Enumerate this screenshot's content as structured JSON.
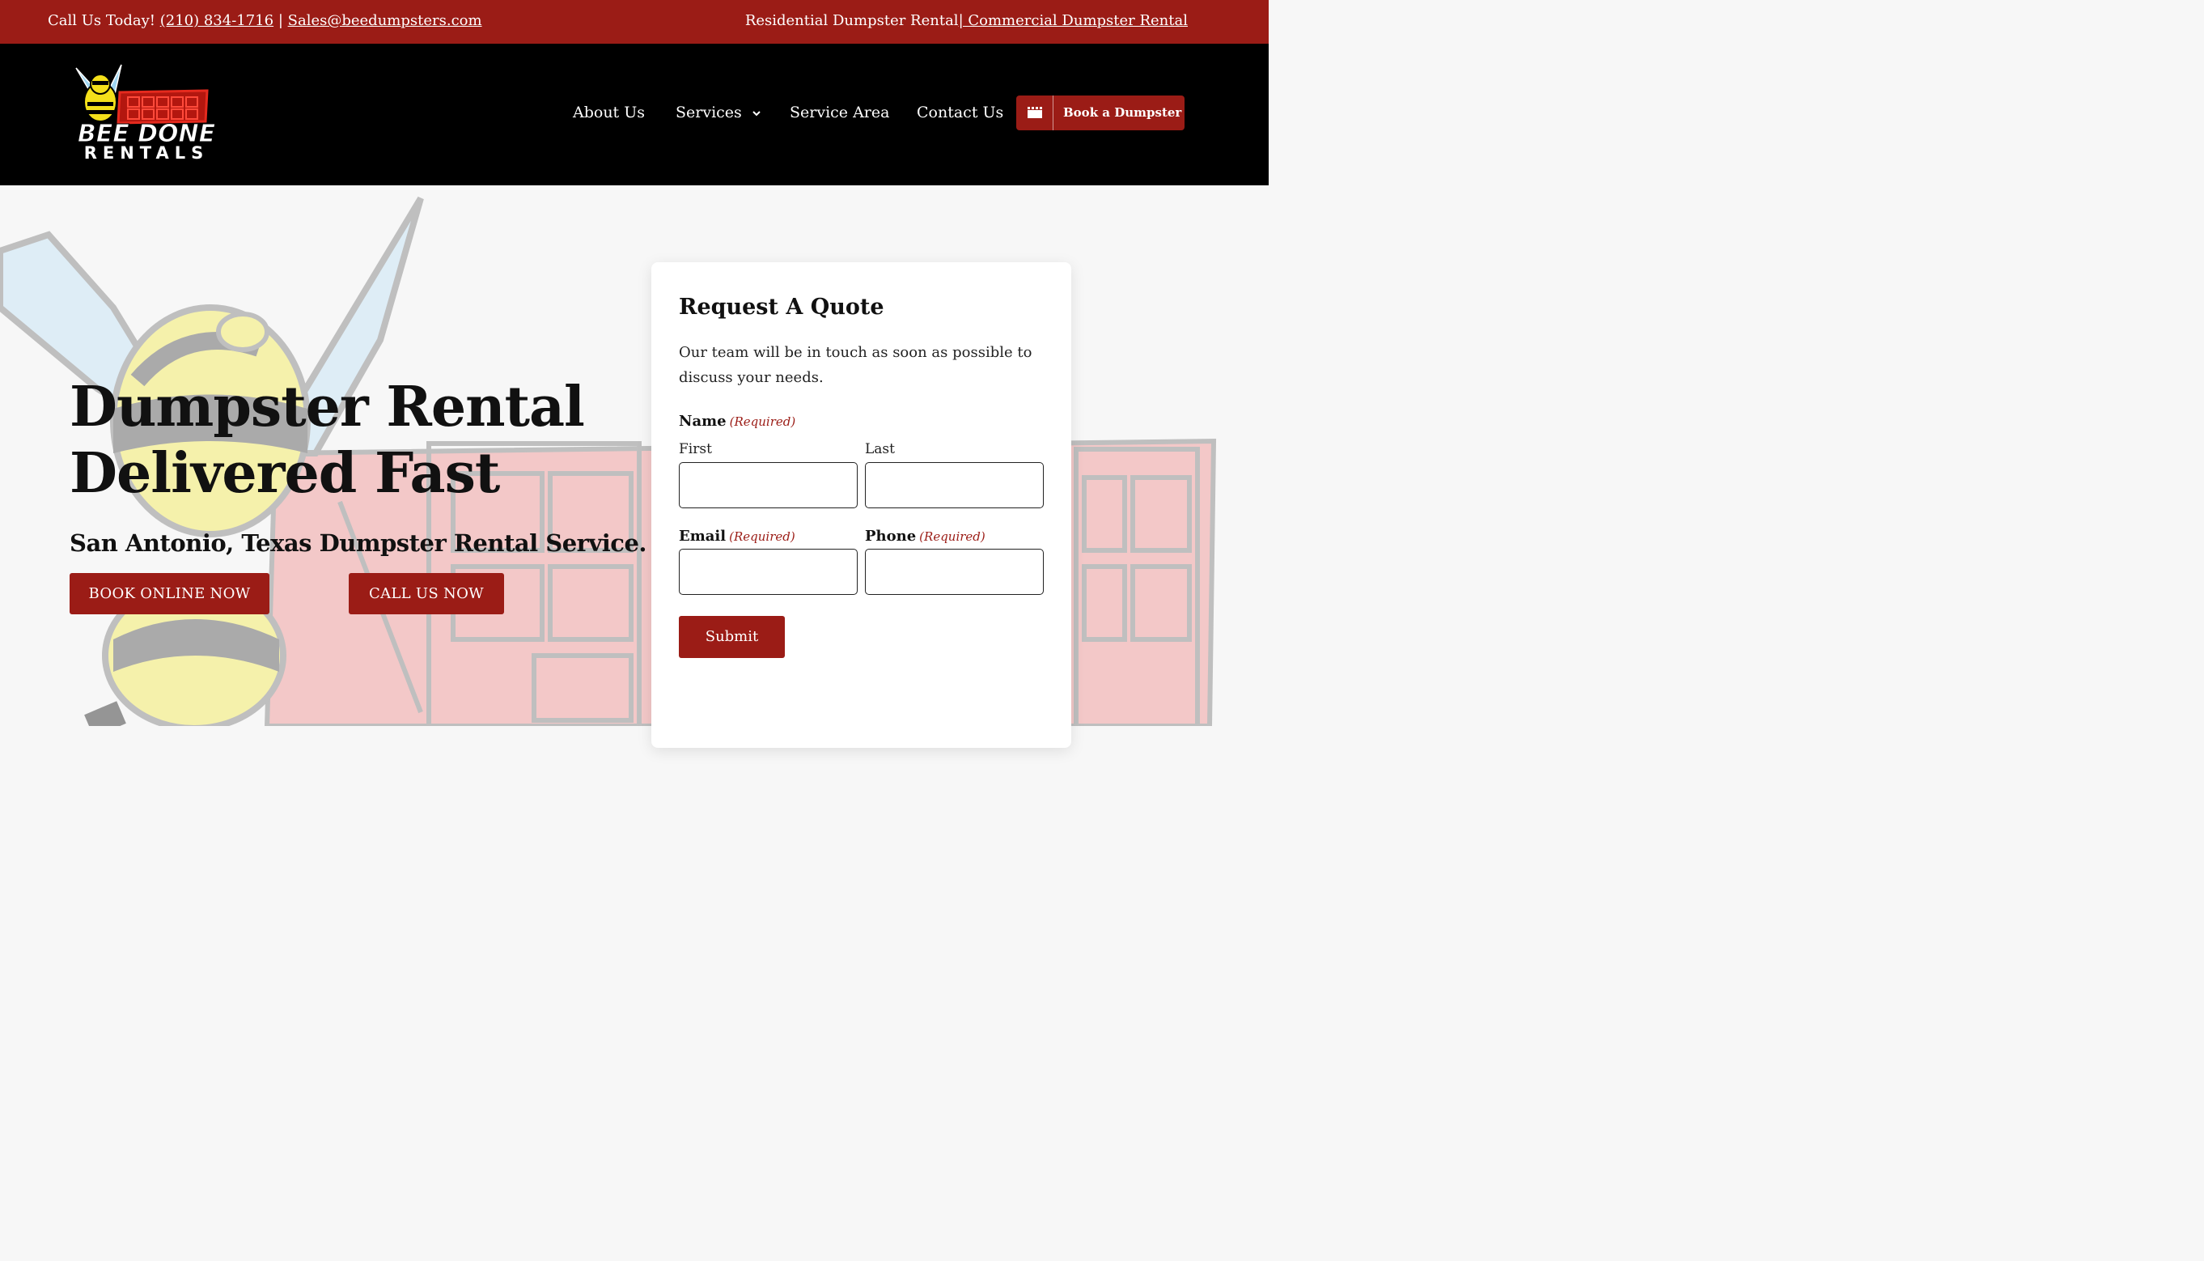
{
  "topbar": {
    "call_prefix": "Call Us Today!",
    "phone": "(210) 834-1716",
    "separator": "|",
    "email": "Sales@beedumpsters.com",
    "residential": "Residential Dumpster Rental",
    "commercial": "| Commercial Dumpster Rental"
  },
  "header": {
    "logo_line1": "BEE DONE",
    "logo_line2": "RENTALS",
    "nav": [
      {
        "label": "About Us"
      },
      {
        "label": "Services"
      },
      {
        "label": "Service Area"
      },
      {
        "label": "Contact Us"
      }
    ],
    "book_button": "Book a Dumpster"
  },
  "hero": {
    "title_line1": "Dumpster Rental",
    "title_line2": "Delivered Fast",
    "subtitle": "San Antonio, Texas Dumpster Rental Service.",
    "cta_book": "BOOK ONLINE NOW",
    "cta_call": "CALL US NOW"
  },
  "quote_form": {
    "title": "Request A Quote",
    "description": "Our team will be in touch as soon as possible to discuss your needs.",
    "name_label": "Name",
    "required_text": "(Required)",
    "first_label": "First",
    "last_label": "Last",
    "email_label": "Email",
    "phone_label": "Phone",
    "first_value": "",
    "last_value": "",
    "email_value": "",
    "phone_value": "",
    "submit": "Submit"
  },
  "colors": {
    "brand_red": "#9b1c16",
    "header_bg": "#000000",
    "page_bg": "#f7f7f7"
  },
  "icons": [
    "chevron-down-icon",
    "dumpster-icon"
  ]
}
